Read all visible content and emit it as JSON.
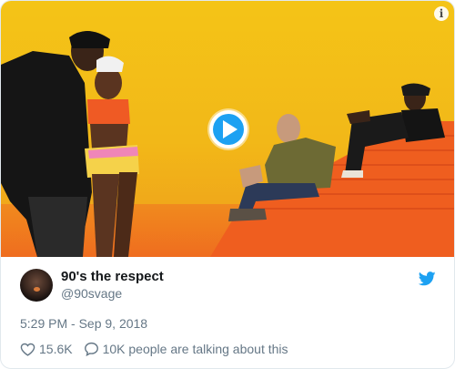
{
  "media": {
    "info_glyph": "i",
    "info_icon": "info-icon",
    "play_icon": "play-icon",
    "accent_color": "#1da1f2"
  },
  "author": {
    "display_name": "90's the respect",
    "handle": "@90svage"
  },
  "timestamp": "5:29 PM - Sep 9, 2018",
  "actions": {
    "likes": "15.6K",
    "talking": "10K people are talking about this"
  },
  "colors": {
    "brand": "#1da1f2",
    "muted_text": "#657786",
    "primary_text": "#14171a"
  }
}
